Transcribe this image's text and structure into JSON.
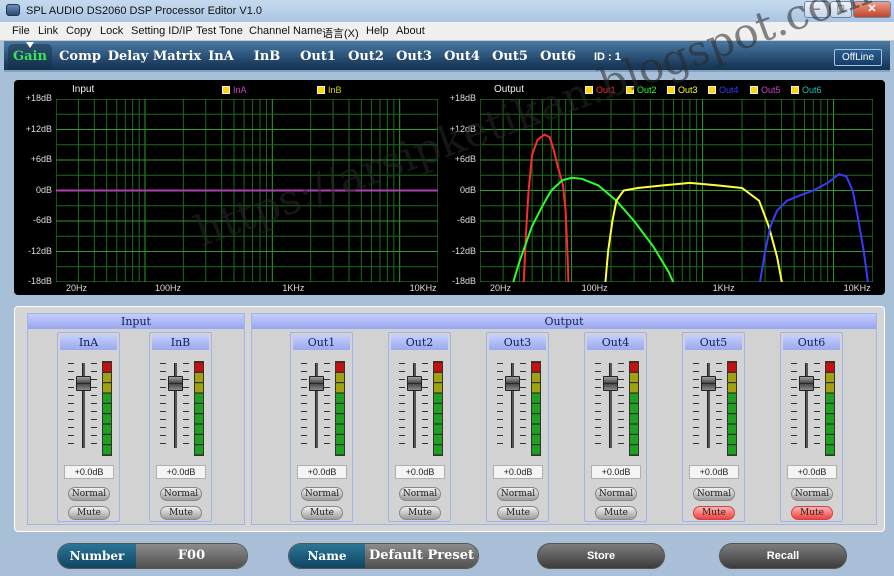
{
  "window": {
    "title": "SPL AUDIO DS2060 DSP Processor Editor V1.0",
    "minimize": "–",
    "maximize": "□",
    "close": "✕"
  },
  "menu": [
    "File",
    "Link",
    "Copy",
    "Lock",
    "Setting ID/IP",
    "Test Tone",
    "Channel Name",
    "语言(X)",
    "Help",
    "About"
  ],
  "tabs": [
    "Gain",
    "Comp",
    "Delay",
    "Matrix",
    "InA",
    "InB",
    "Out1",
    "Out2",
    "Out3",
    "Out4",
    "Out5",
    "Out6"
  ],
  "selected_tab": "Gain",
  "device_id": "ID : 1",
  "status_button": "OffLine",
  "input_graph": {
    "title": "Input",
    "legend": [
      "InA",
      "InB"
    ],
    "legend_colors": [
      "#cc44cc",
      "#d4d400"
    ]
  },
  "output_graph": {
    "title": "Output",
    "legend": [
      "Out1",
      "Out2",
      "Out3",
      "Out4",
      "Out5",
      "Out6"
    ],
    "legend_colors": [
      "#ff2a2a",
      "#2aff2a",
      "#ffff3a",
      "#3a3aff",
      "#cc44cc",
      "#20c0c0"
    ]
  },
  "y_axis_labels": [
    "+18dB",
    "+12dB",
    "+6dB",
    "0dB",
    "-6dB",
    "-12dB",
    "-18dB"
  ],
  "x_axis_labels": [
    "20Hz",
    "100Hz",
    "1KHz",
    "10KHz"
  ],
  "input_panel": {
    "title": "Input",
    "channels": [
      {
        "name": "InA",
        "gain": "+0.0dB",
        "mode": "Normal",
        "mute": "Mute",
        "muted": false,
        "fader_level": 0.77,
        "meter_level": 0.69
      },
      {
        "name": "InB",
        "gain": "+0.0dB",
        "mode": "Normal",
        "mute": "Mute",
        "muted": false,
        "fader_level": 0.77,
        "meter_level": 0.69
      }
    ]
  },
  "output_panel": {
    "title": "Output",
    "channels": [
      {
        "name": "Out1",
        "gain": "+0.0dB",
        "mode": "Normal",
        "mute": "Mute",
        "muted": false,
        "fader_level": 0.77,
        "meter_level": 0.63
      },
      {
        "name": "Out2",
        "gain": "+0.0dB",
        "mode": "Normal",
        "mute": "Mute",
        "muted": false,
        "fader_level": 0.77,
        "meter_level": 0.63
      },
      {
        "name": "Out3",
        "gain": "+0.0dB",
        "mode": "Normal",
        "mute": "Mute",
        "muted": false,
        "fader_level": 0.77,
        "meter_level": 0.63
      },
      {
        "name": "Out4",
        "gain": "+0.0dB",
        "mode": "Normal",
        "mute": "Mute",
        "muted": false,
        "fader_level": 0.77,
        "meter_level": 0.63
      },
      {
        "name": "Out5",
        "gain": "+0.0dB",
        "mode": "Normal",
        "mute": "Mute",
        "muted": true,
        "fader_level": 0.77,
        "meter_level": 0.63
      },
      {
        "name": "Out6",
        "gain": "+0.0dB",
        "mode": "Normal",
        "mute": "Mute",
        "muted": true,
        "fader_level": 0.77,
        "meter_level": 0.63
      }
    ]
  },
  "footer": {
    "number_label": "Number",
    "number_value": "F00",
    "name_label": "Name",
    "name_value": "Default Preset",
    "store": "Store",
    "recall": "Recall"
  },
  "watermark": "https://arsipketikan.blogspot.com"
}
